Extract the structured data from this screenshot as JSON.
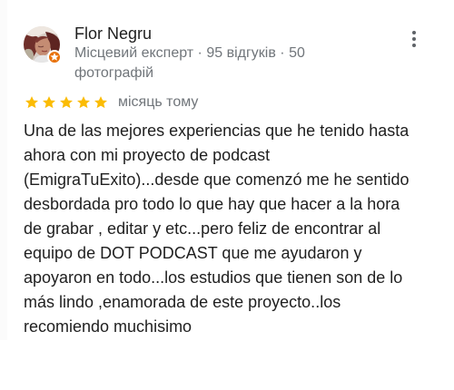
{
  "review": {
    "author": {
      "name": "Flor Negru",
      "meta": "Місцевий експерт · 95 відгуків · 50 фотографій",
      "avatar_icon": "reviewer-avatar",
      "badge_icon": "local-guide-badge-icon"
    },
    "menu_icon": "more-vert-icon",
    "rating": {
      "stars": 5,
      "max_stars": 5,
      "time": "місяць тому",
      "star_color": "#fbbc04"
    },
    "text": "Una de las mejores experiencias que he tenido hasta ahora con mi proyecto de podcast (EmigraTuExito)...desde que comenzó me he sentido desbordada pro todo lo que hay que hacer a la hora de grabar , editar y etc...pero feliz de encontrar al equipo de DOT PODCAST que me ayudaron y apoyaron en todo...los estudios que tienen son de lo más lindo ,enamorada de este proyecto..los recomiendo muchisimo"
  }
}
